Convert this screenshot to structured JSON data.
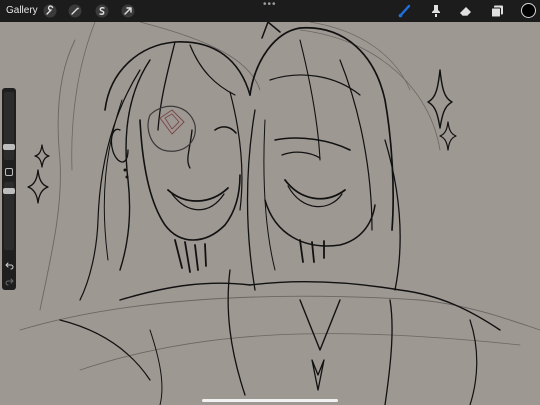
{
  "topbar": {
    "gallery_label": "Gallery",
    "more_menu": "•••",
    "left_tools": [
      "wrench-icon",
      "magic-wand-icon",
      "selection-icon",
      "transform-arrow-icon"
    ],
    "right_tools": [
      "brush-icon",
      "smudge-icon",
      "eraser-icon",
      "layers-icon"
    ],
    "active_tool": "brush-icon",
    "active_tool_color": "#1e6fe0",
    "current_color": "#000000"
  },
  "canvas": {
    "background_color": "#9e9893",
    "stroke_color": "#111111"
  },
  "sidebar": {
    "brush_size_level": 0.55,
    "opacity_level": 0.5
  }
}
